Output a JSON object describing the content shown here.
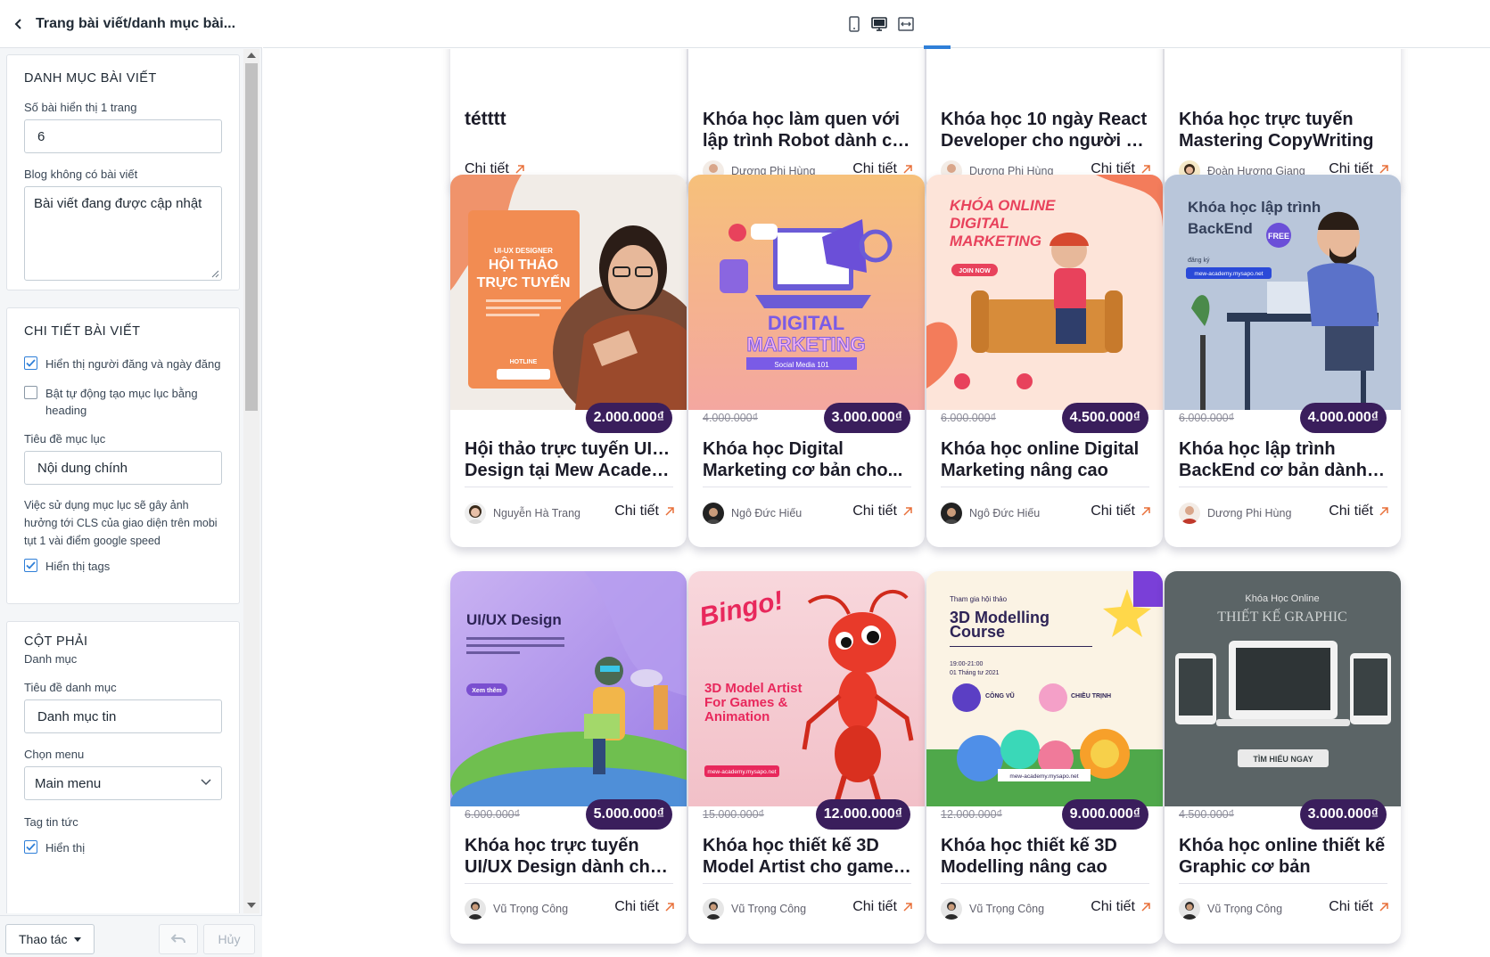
{
  "sidebar": {
    "title": "Trang bài viết/danh mục bài...",
    "category_panel": {
      "title": "DANH MỤC BÀI VIẾT",
      "per_page_label": "Số bài hiển thị 1 trang",
      "per_page_value": "6",
      "empty_label": "Blog không có bài viết",
      "empty_value": "Bài viết đang được cập nhật"
    },
    "detail_panel": {
      "title": "CHI TIẾT BÀI VIẾT",
      "show_author_label": "Hiển thị người đăng và ngày đăng",
      "show_author_checked": true,
      "auto_toc_label": "Bật tự động tạo mục lục bằng heading",
      "auto_toc_checked": false,
      "toc_title_label": "Tiêu đề mục lục",
      "toc_title_value": "Nội dung chính",
      "note": "Việc sử dụng mục lục sẽ gây ảnh hưởng tới CLS của giao diện trên mobi tụt 1 vài điểm google speed",
      "show_tags_label": "Hiển thị tags",
      "show_tags_checked": true
    },
    "right_col_panel": {
      "title": "CỘT PHẢI",
      "subtitle": "Danh mục",
      "category_title_label": "Tiêu đề danh mục",
      "category_title_value": "Danh mục tin",
      "menu_label": "Chọn menu",
      "menu_value": "Main menu",
      "tag_label": "Tag tin tức",
      "tag_show_label": "Hiển thị",
      "tag_show_checked": true
    },
    "footer": {
      "actions_label": "Thao tác",
      "cancel_label": "Hủy"
    }
  },
  "toolbar": {
    "devices": [
      "mobile-icon",
      "desktop-icon",
      "fullwidth-icon"
    ],
    "active_device": "desktop-icon"
  },
  "detail_label": "Chi tiết",
  "cards": [
    {
      "row": 0,
      "title1": "tétttt",
      "title2": "",
      "author": "",
      "price_old": "",
      "price_new": ""
    },
    {
      "row": 0,
      "title1": "Khóa học làm quen với",
      "title2": "lập trình Robot dành ch...",
      "author": "Dương Phi Hùng"
    },
    {
      "row": 0,
      "title1": "Khóa học 10 ngày React",
      "title2": "Developer cho người m...",
      "author": "Dương Phi Hùng"
    },
    {
      "row": 0,
      "title1": "Khóa học trực tuyến",
      "title2": "Mastering CopyWriting",
      "author": "Đoàn Hương Giang"
    },
    {
      "row": 1,
      "title1": "Hội thảo trực tuyến UI/UX",
      "title2": "Design tại Mew Academy",
      "author": "Nguyễn Hà Trang",
      "price_old": "",
      "price_new": "2.000.000₫"
    },
    {
      "row": 1,
      "title1": "Khóa học Digital",
      "title2": "Marketing cơ bản cho...",
      "author": "Ngô Đức Hiếu",
      "price_old": "4.000.000₫",
      "price_new": "3.000.000₫"
    },
    {
      "row": 1,
      "title1": "Khóa học online Digital",
      "title2": "Marketing nâng cao",
      "author": "Ngô Đức Hiếu",
      "price_old": "6.000.000₫",
      "price_new": "4.500.000₫"
    },
    {
      "row": 1,
      "title1": "Khóa học lập trình",
      "title2": "BackEnd cơ bản dành c...",
      "author": "Dương Phi Hùng",
      "price_old": "6.000.000₫",
      "price_new": "4.000.000₫"
    },
    {
      "row": 2,
      "title1": "Khóa học trực tuyến",
      "title2": "UI/UX Design dành cho...",
      "author": "Vũ Trọng Công",
      "price_old": "6.000.000₫",
      "price_new": "5.000.000₫"
    },
    {
      "row": 2,
      "title1": "Khóa học thiết kế 3D",
      "title2": "Model Artist cho game ...",
      "author": "Vũ Trọng Công",
      "price_old": "15.000.000₫",
      "price_new": "12.000.000₫"
    },
    {
      "row": 2,
      "title1": "Khóa học thiết kế 3D",
      "title2": "Modelling nâng cao",
      "author": "Vũ Trọng Công",
      "price_old": "12.000.000₫",
      "price_new": "9.000.000₫"
    },
    {
      "row": 2,
      "title1": "Khóa học online thiết kế",
      "title2": "Graphic cơ bản",
      "author": "Vũ Trọng Công",
      "price_old": "4.500.000₫",
      "price_new": "3.000.000₫"
    }
  ],
  "images": {
    "uiux_event": {
      "line1": "UI-UX DESIGNER",
      "line2": "HỘI THẢO",
      "line3": "TRỰC TUYẾN",
      "line4": "HOTLINE"
    },
    "digital": {
      "line1": "DIGITAL",
      "line2": "MARKETING",
      "line3": "Social Media 101"
    },
    "dm_online": {
      "line1": "KHÓA ONLINE",
      "line2": "DIGITAL",
      "line3": "MARKETING",
      "line4": "JOIN NOW"
    },
    "backend": {
      "line1": "Khóa học lập trình",
      "line2": "BackEnd",
      "line3": "FREE",
      "line4": "đăng ký",
      "line5": "mew-academy.mysapo.net"
    },
    "uiux_course": {
      "line1": "UI/UX Design",
      "line2": "Xem thêm"
    },
    "bingo": {
      "line1": "Bingo!",
      "line2": "3D Model Artist",
      "line3": "For Games &",
      "line4": "Animation",
      "line5": "mew-academy.mysapo.net"
    },
    "modelling": {
      "line1": "Tham gia hội thảo",
      "line2": "3D Modelling",
      "line3": "Course",
      "line4": "19:00-21:00",
      "line5": "01 Tháng tư 2021",
      "line6": "CÔNG VŨ",
      "line7": "CHIỀU TRỊNH",
      "line8": "mew-academy.mysapo.net"
    },
    "graphic": {
      "line1": "Khóa Học Online",
      "line2": "THIẾT KẾ GRAPHIC",
      "line3": "TÌM HIỂU NGAY"
    }
  }
}
